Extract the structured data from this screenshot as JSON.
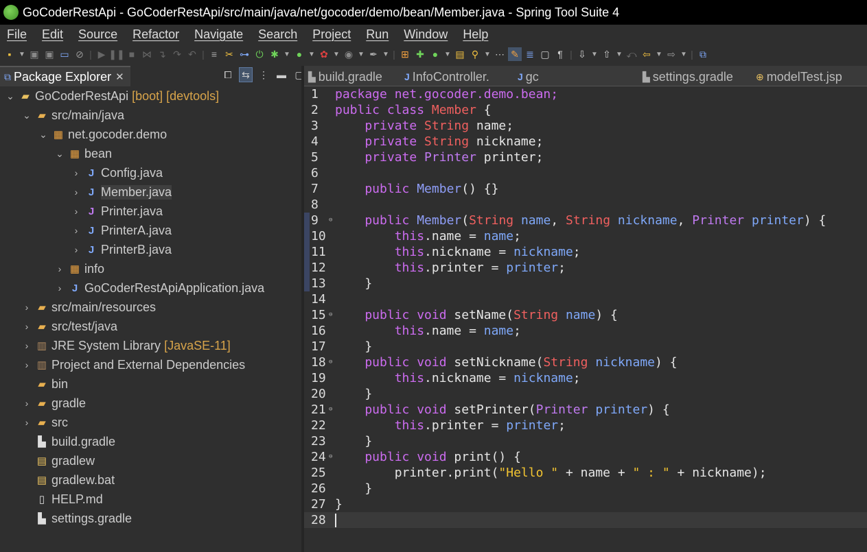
{
  "window": {
    "title": "GoCoderRestApi - GoCoderRestApi/src/main/java/net/gocoder/demo/bean/Member.java - Spring Tool Suite 4"
  },
  "menu": [
    {
      "label": "File"
    },
    {
      "label": "Edit"
    },
    {
      "label": "Source"
    },
    {
      "label": "Refactor"
    },
    {
      "label": "Navigate"
    },
    {
      "label": "Search"
    },
    {
      "label": "Project"
    },
    {
      "label": "Run"
    },
    {
      "label": "Window"
    },
    {
      "label": "Help"
    }
  ],
  "package_explorer": {
    "title": "Package Explorer",
    "close": "✕",
    "tree": [
      {
        "label": "GoCoderRestApi",
        "decoration": "[boot] [devtools]",
        "icon": "project-icon"
      },
      {
        "label": "src/main/java",
        "icon": "source-folder-icon"
      },
      {
        "label": "net.gocoder.demo",
        "icon": "package-icon"
      },
      {
        "label": "bean",
        "icon": "package-icon"
      },
      {
        "label": "Config.java",
        "icon": "java-file-icon"
      },
      {
        "label": "Member.java",
        "icon": "java-file-icon"
      },
      {
        "label": "Printer.java",
        "icon": "java-interface-icon"
      },
      {
        "label": "PrinterA.java",
        "icon": "java-file-icon"
      },
      {
        "label": "PrinterB.java",
        "icon": "java-file-icon"
      },
      {
        "label": "info",
        "icon": "package-icon"
      },
      {
        "label": "GoCoderRestApiApplication.java",
        "icon": "java-file-icon"
      },
      {
        "label": "src/main/resources",
        "icon": "source-folder-icon"
      },
      {
        "label": "src/test/java",
        "icon": "source-folder-icon"
      },
      {
        "label": "JRE System Library",
        "decoration": "[JavaSE-11]",
        "icon": "library-icon"
      },
      {
        "label": "Project and External Dependencies",
        "icon": "library-icon"
      },
      {
        "label": "bin",
        "icon": "folder-icon"
      },
      {
        "label": "gradle",
        "icon": "folder-icon"
      },
      {
        "label": "src",
        "icon": "folder-icon"
      },
      {
        "label": "build.gradle",
        "icon": "gradle-file-icon"
      },
      {
        "label": "gradlew",
        "icon": "file-icon"
      },
      {
        "label": "gradlew.bat",
        "icon": "file-icon"
      },
      {
        "label": "HELP.md",
        "icon": "file-icon"
      },
      {
        "label": "settings.gradle",
        "icon": "gradle-file-icon"
      }
    ]
  },
  "editor_tabs": [
    {
      "label": "build.gradle",
      "icon": "gradle-file-icon"
    },
    {
      "label": "InfoController.",
      "icon": "java-file-icon"
    },
    {
      "label": "gc",
      "icon": "java-file-icon"
    },
    {
      "label": "settings.gradle",
      "icon": "gradle-file-icon"
    },
    {
      "label": "modelTest.jsp",
      "icon": "jsp-file-icon"
    }
  ],
  "code": {
    "line_numbers": [
      "1",
      "2",
      "3",
      "4",
      "5",
      "6",
      "7",
      "8",
      "9",
      "10",
      "11",
      "12",
      "13",
      "14",
      "15",
      "16",
      "17",
      "18",
      "19",
      "20",
      "21",
      "22",
      "23",
      "24",
      "25",
      "26",
      "27",
      "28"
    ],
    "l1": {
      "a": "package net.gocoder.demo.bean;"
    },
    "l2": {
      "a": "public",
      "b": " ",
      "c": "class",
      "d": " ",
      "e": "Member",
      "f": " {"
    },
    "l3": {
      "a": "    private ",
      "b": "String",
      "c": " name;"
    },
    "l4": {
      "a": "    private ",
      "b": "String",
      "c": " nickname;"
    },
    "l5": {
      "a": "    private ",
      "b": "Printer",
      "c": " printer;"
    },
    "l7": {
      "a": "    public ",
      "b": "Member",
      "c": "() {}"
    },
    "l9": {
      "a": "    public ",
      "b": "Member",
      "c": "(",
      "d": "String",
      "e": " ",
      "f": "name",
      "g": ", ",
      "h": "String",
      "i": " ",
      "j": "nickname",
      "k": ", ",
      "l": "Printer",
      "m": " ",
      "n": "printer",
      "o": ") {"
    },
    "l10": {
      "a": "        this",
      "b": ".name = ",
      "c": "name",
      "d": ";"
    },
    "l11": {
      "a": "        this",
      "b": ".nickname = ",
      "c": "nickname",
      "d": ";"
    },
    "l12": {
      "a": "        this",
      "b": ".printer = ",
      "c": "printer",
      "d": ";"
    },
    "l13": {
      "a": "    }"
    },
    "l15": {
      "a": "    public void ",
      "b": "setName(",
      "c": "String",
      "d": " ",
      "e": "name",
      "f": ") {"
    },
    "l16": {
      "a": "        this",
      "b": ".name = ",
      "c": "name",
      "d": ";"
    },
    "l17": {
      "a": "    }"
    },
    "l18": {
      "a": "    public void ",
      "b": "setNickname(",
      "c": "String",
      "d": " ",
      "e": "nickname",
      "f": ") {"
    },
    "l19": {
      "a": "        this",
      "b": ".nickname = ",
      "c": "nickname",
      "d": ";"
    },
    "l20": {
      "a": "    }"
    },
    "l21": {
      "a": "    public void ",
      "b": "setPrinter(",
      "c": "Printer",
      "d": " ",
      "e": "printer",
      "f": ") {"
    },
    "l22": {
      "a": "        this",
      "b": ".printer = ",
      "c": "printer",
      "d": ";"
    },
    "l23": {
      "a": "    }"
    },
    "l24": {
      "a": "    public void ",
      "b": "print() {"
    },
    "l25": {
      "a": "        printer.print(",
      "b": "\"Hello \"",
      "c": " + name + ",
      "d": "\" : \"",
      "e": " + nickname);"
    },
    "l26": {
      "a": "    }"
    },
    "l27": {
      "a": "}"
    }
  }
}
